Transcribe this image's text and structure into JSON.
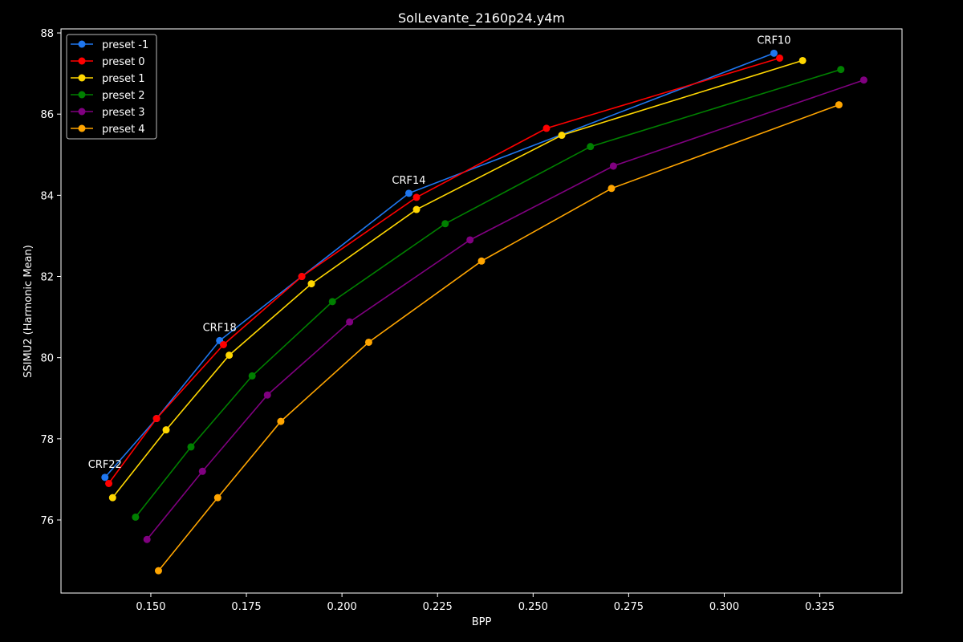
{
  "chart_data": {
    "type": "line",
    "title": "SolLevante_2160p24.y4m",
    "xlabel": "BPP",
    "ylabel": "SSIMU2 (Harmonic Mean)",
    "xlim": [
      0.1265,
      0.3465
    ],
    "ylim": [
      74.2,
      88.1
    ],
    "xticks": [
      0.15,
      0.175,
      0.2,
      0.225,
      0.25,
      0.275,
      0.3,
      0.325
    ],
    "xtick_labels": [
      "0.150",
      "0.175",
      "0.200",
      "0.225",
      "0.250",
      "0.275",
      "0.300",
      "0.325"
    ],
    "yticks": [
      76,
      78,
      80,
      82,
      84,
      86,
      88
    ],
    "ytick_labels": [
      "76",
      "78",
      "80",
      "82",
      "84",
      "86",
      "88"
    ],
    "grid": false,
    "legend_position": "upper-left",
    "series": [
      {
        "name": "preset -1",
        "color": "#1f77f0",
        "x": [
          0.138,
          0.1515,
          0.168,
          0.1895,
          0.2175,
          0.313
        ],
        "y": [
          77.05,
          78.5,
          80.42,
          82.0,
          84.05,
          87.5
        ]
      },
      {
        "name": "preset 0",
        "color": "#ff0000",
        "x": [
          0.139,
          0.1515,
          0.169,
          0.1895,
          0.2195,
          0.2535,
          0.3145
        ],
        "y": [
          76.9,
          78.5,
          80.32,
          82.0,
          83.95,
          85.65,
          87.38
        ]
      },
      {
        "name": "preset 1",
        "color": "#ffd700",
        "x": [
          0.14,
          0.154,
          0.1705,
          0.192,
          0.2195,
          0.2575,
          0.3205
        ],
        "y": [
          76.55,
          78.22,
          80.06,
          81.82,
          83.65,
          85.48,
          87.32
        ]
      },
      {
        "name": "preset 2",
        "color": "#008000",
        "x": [
          0.146,
          0.1605,
          0.1765,
          0.1975,
          0.227,
          0.265,
          0.3305
        ],
        "y": [
          76.07,
          77.8,
          79.55,
          81.38,
          83.3,
          85.2,
          87.1
        ]
      },
      {
        "name": "preset 3",
        "color": "#800080",
        "x": [
          0.149,
          0.1635,
          0.1805,
          0.202,
          0.2335,
          0.271,
          0.3365
        ],
        "y": [
          75.52,
          77.2,
          79.08,
          80.88,
          82.9,
          84.72,
          86.84
        ]
      },
      {
        "name": "preset 4",
        "color": "#ffa500",
        "x": [
          0.152,
          0.1675,
          0.184,
          0.207,
          0.2365,
          0.2705,
          0.33
        ],
        "y": [
          74.75,
          76.55,
          78.43,
          80.38,
          82.38,
          84.17,
          86.23
        ]
      }
    ],
    "annotations": [
      {
        "text": "CRF22",
        "x": 0.138,
        "y": 77.05
      },
      {
        "text": "CRF18",
        "x": 0.168,
        "y": 80.42
      },
      {
        "text": "CRF14",
        "x": 0.2175,
        "y": 84.05
      },
      {
        "text": "CRF10",
        "x": 0.313,
        "y": 87.5
      }
    ]
  }
}
